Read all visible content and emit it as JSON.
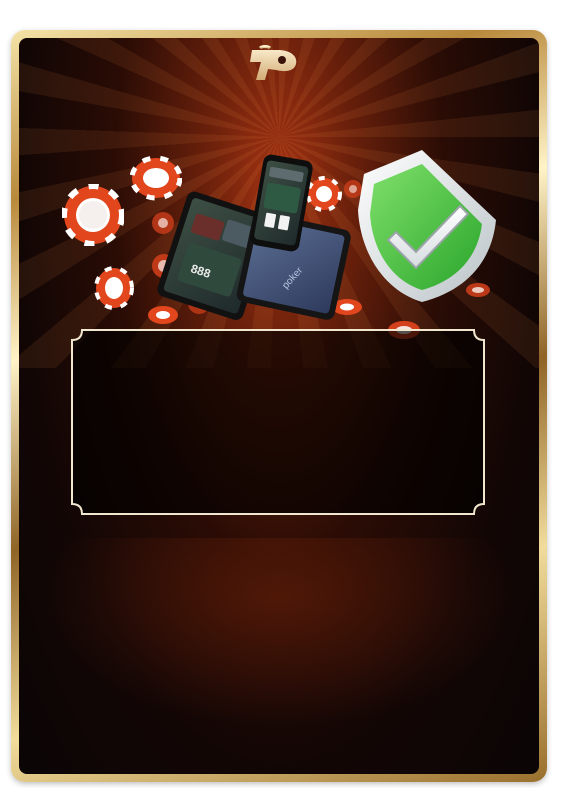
{
  "card": {
    "frame_color": "#c79b4a",
    "background_color": "#140706",
    "accent_color": "#d9461a"
  },
  "logo": {
    "icon": "poker-brand-logo-icon"
  },
  "hero": {
    "devices_icon": "tablet-phone-icon",
    "shield_icon": "green-check-shield-icon",
    "chip_icon": "poker-chip-icon"
  },
  "panel": {
    "body_text": ""
  }
}
